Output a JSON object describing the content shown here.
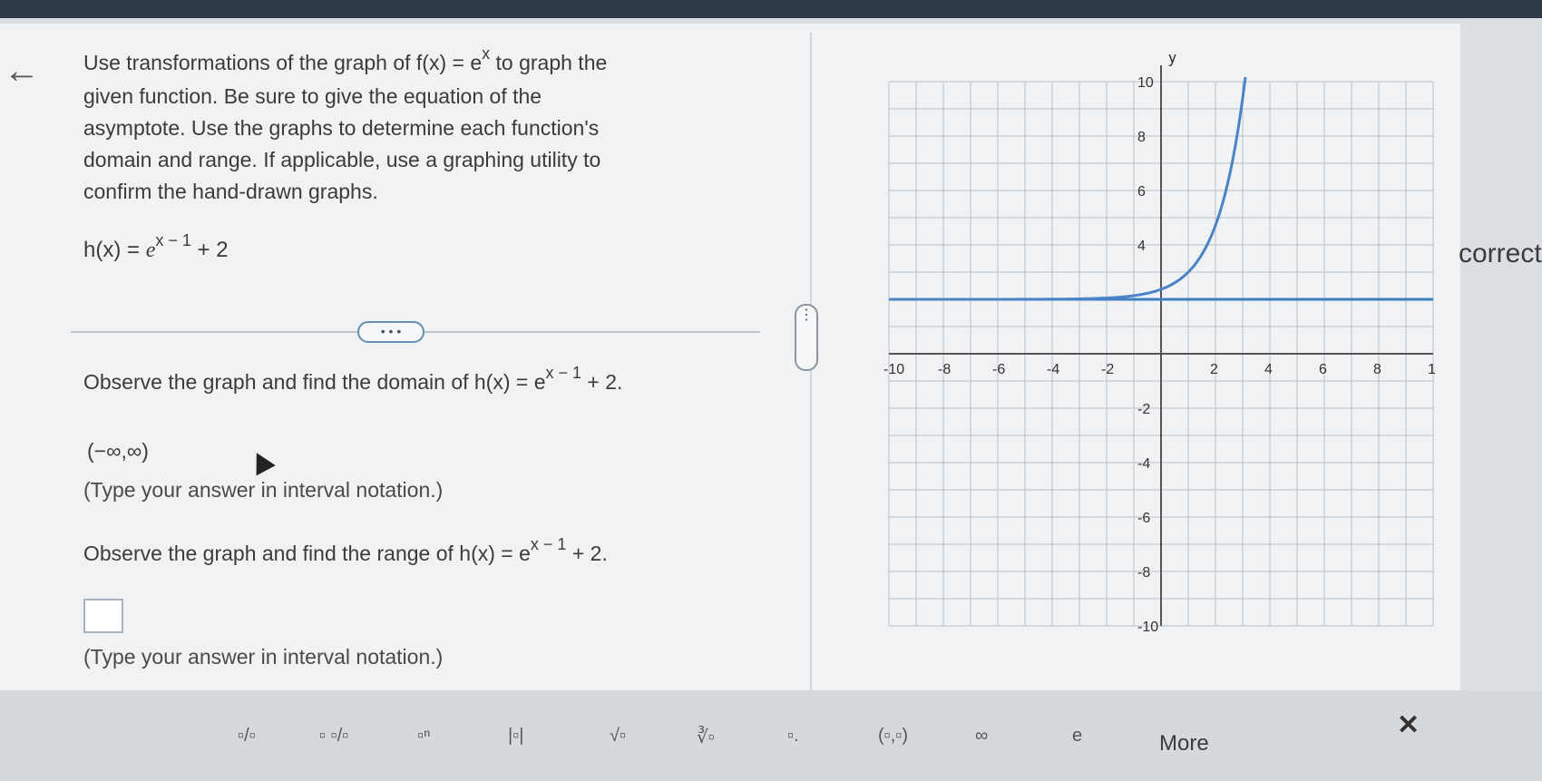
{
  "question": {
    "line1": "Use transformations of the graph of f(x) = e",
    "line1_sup": "x",
    "line1_end": " to graph the",
    "line2": "given function. Be sure to give the equation of the",
    "line3": "asymptote. Use the graphs to determine each function's",
    "line4": "domain and range. If applicable, use a graphing utility to",
    "line5": "confirm the hand-drawn graphs."
  },
  "function": {
    "lhs": "h(x) = ",
    "base": "e",
    "exponent": "x − 1",
    "rest": " + 2"
  },
  "more_pill": "• • •",
  "domain_part": {
    "prompt": "Observe the graph and find the domain of h(x) = e",
    "prompt_sup": "x − 1",
    "prompt_end": " + 2.",
    "answer": "(−∞,∞)",
    "hint": "(Type your answer in interval notation.)"
  },
  "range_part": {
    "prompt": "Observe the graph and find the range of h(x) = e",
    "prompt_sup": "x − 1",
    "prompt_end": " + 2.",
    "answer": "",
    "hint": "(Type your answer in interval notation.)"
  },
  "side_text": "correct:",
  "graph": {
    "y_axis_label": "y",
    "x_ticks": [
      "-10",
      "-8",
      "-6",
      "-4",
      "-2",
      "2",
      "4",
      "6",
      "8",
      "1"
    ],
    "y_ticks": [
      "10",
      "8",
      "6",
      "4",
      "-2",
      "-4",
      "-6",
      "-8",
      "-10"
    ],
    "curve_color": "#4a84c6",
    "asymptote_color": "#3e7fc4"
  },
  "toolbar": {
    "items": [
      "▫/▫",
      "▫ ▫/▫",
      "▫ⁿ",
      "|▫|",
      "√▫",
      "∛▫",
      "▫.",
      "(▫,▫)",
      "∞",
      "e"
    ],
    "more_label": "More",
    "close_label": "✕"
  },
  "colors": {
    "top_bar": "#2f3a48",
    "panel_bg": "#f1f2f3",
    "accent_blue": "#4a84c6"
  }
}
